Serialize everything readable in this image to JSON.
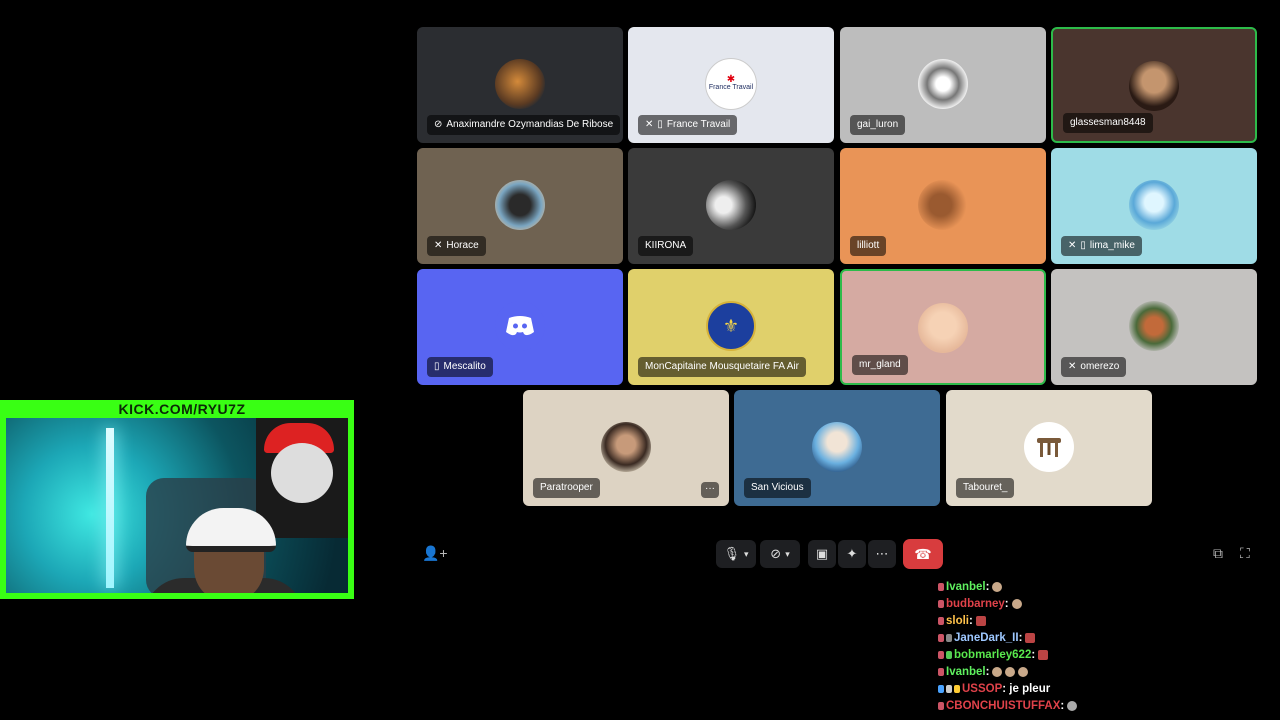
{
  "webcam": {
    "banner": "KICK.COM/RYU7Z"
  },
  "call": {
    "tiles": [
      {
        "name": "Anaximandre Ozymandias De Ribose",
        "icons": [
          "camera-off-icon"
        ],
        "bg": "#2b2d31"
      },
      {
        "name": "France Travail",
        "icons": [
          "muted-mic-icon",
          "mobile-icon"
        ],
        "bg": "#e4e7ee",
        "avatar_text": "France Travail"
      },
      {
        "name": "gai_luron",
        "icons": [],
        "bg": "#bdbdbd"
      },
      {
        "name": "glassesman8448",
        "icons": [],
        "bg": "#4a352e",
        "speaking": true
      },
      {
        "name": "Horace",
        "icons": [
          "muted-mic-icon"
        ],
        "bg": "#6f6251"
      },
      {
        "name": "KIIRONA",
        "icons": [],
        "bg": "#3a3a3a"
      },
      {
        "name": "lilliott",
        "icons": [],
        "bg": "#e99457"
      },
      {
        "name": "lima_mike",
        "icons": [
          "muted-mic-icon",
          "mobile-icon"
        ],
        "bg": "#9fdce6"
      },
      {
        "name": "Mescalito",
        "icons": [
          "mobile-icon"
        ],
        "bg": "#5865f2"
      },
      {
        "name": "MonCapitaine Mousquetaire FA Air",
        "icons": [],
        "bg": "#e0d06b"
      },
      {
        "name": "mr_gland",
        "icons": [],
        "bg": "#d5aaa2",
        "speaking": true
      },
      {
        "name": "omerezo",
        "icons": [
          "muted-mic-icon"
        ],
        "bg": "#c4c2c0"
      },
      {
        "name": "Paratrooper",
        "icons": [],
        "bg": "#ddd3c3"
      },
      {
        "name": "San Vicious",
        "icons": [],
        "bg": "#3e6b93"
      },
      {
        "name": "Tabouret_",
        "icons": [],
        "bg": "#e2dacb"
      }
    ],
    "more_label": "···"
  },
  "chat": [
    {
      "user": "Ivanbel",
      "color": "#5ff05f",
      "message": ""
    },
    {
      "user": "budbarney",
      "color": "#e0424a",
      "message": ""
    },
    {
      "user": "sloli",
      "color": "#ffc24b",
      "message": ""
    },
    {
      "user": "JaneDark_II",
      "color": "#9ec8ff",
      "message": ""
    },
    {
      "user": "bobmarley622",
      "color": "#59e84d",
      "message": ""
    },
    {
      "user": "Ivanbel",
      "color": "#5ff05f",
      "message": ""
    },
    {
      "user": "USSOP",
      "color": "#e0424a",
      "message": "je pleur"
    },
    {
      "user": "CBONCHUISTUFFAX",
      "color": "#e0424a",
      "message": ""
    }
  ],
  "colors": {
    "accent_green": "#39ff14",
    "hangup_red": "#d83c3e",
    "speaking_green": "#2dbb4a"
  }
}
